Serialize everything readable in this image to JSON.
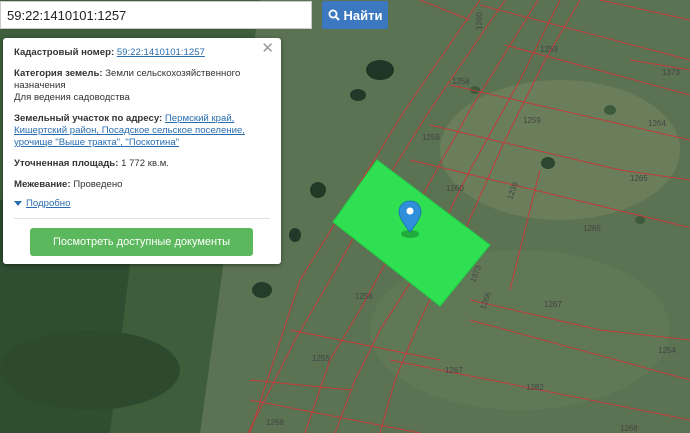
{
  "search": {
    "value": "59:22:1410101:1257",
    "button_label": "Найти",
    "icon": "search-icon"
  },
  "popup": {
    "cadastral_label": "Кадастровый номер:",
    "cadastral_value": "59:22:1410101:1257",
    "category_label": "Категория земель:",
    "category_value": "Земли сельскохозяйственного назначения",
    "usage": "Для ведения садоводства",
    "address_label": "Земельный участок по адресу:",
    "address_value": "Пермский край, Кишертский район, Посадское сельское поселение, урочище \"Выше тракта\", \"Поскотина\"",
    "area_label": "Уточненная площадь:",
    "area_value": "1 772 кв.м.",
    "survey_label": "Межевание:",
    "survey_value": "Проведено",
    "more_label": "Подробно",
    "docs_button": "Посмотреть доступные документы",
    "close_icon": "close-icon"
  },
  "parcel_labels": [
    "1260",
    "1259",
    "1258",
    "1259",
    "1258",
    "1239",
    "1260",
    "1373",
    "1264",
    "1265",
    "1373",
    "1266",
    "1256",
    "1265",
    "1255",
    "1267",
    "1267",
    "1282",
    "1254",
    "1268",
    "1268"
  ],
  "colors": {
    "highlight": "#2ee052",
    "boundary": "#c23a3a",
    "link": "#2a6db0",
    "button": "#5cb85c",
    "search": "#3b78c0"
  }
}
